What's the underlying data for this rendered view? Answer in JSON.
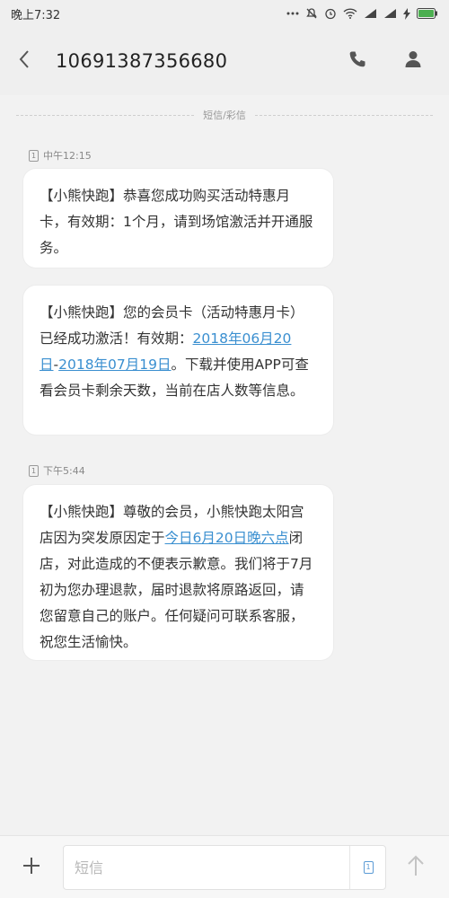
{
  "status_bar": {
    "time": "晚上7:32",
    "battery_color": "#4caf50"
  },
  "header": {
    "title": "10691387356680",
    "back_icon": "chevron-left-icon",
    "call_icon": "phone-icon",
    "contact_icon": "person-icon"
  },
  "divider": {
    "label": "短信/彩信"
  },
  "timestamps": [
    {
      "sim": "1",
      "time": "中午12:15"
    },
    {
      "sim": "1",
      "time": "下午5:44"
    }
  ],
  "messages": [
    {
      "text": "【小熊快跑】恭喜您成功购买活动特惠月卡，有效期：1个月，请到场馆激活并开通服务。"
    },
    {
      "text_pre": "【小熊快跑】您的会员卡（活动特惠月卡）已经成功激活！有效期：",
      "link1": "2018年06月20日",
      "text_mid": "-",
      "link2": "2018年07月19日",
      "text_post": "。下载并使用APP可查看会员卡剩余天数，当前在店人数等信息。"
    },
    {
      "text_pre": "【小熊快跑】尊敬的会员，小熊快跑太阳宫店因为突发原因定于",
      "link1": "今日6月20日晚六点",
      "text_post": "闭店，对此造成的不便表示歉意。我们将于7月初为您办理退款，届时退款将原路返回，请您留意自己的账户。任何疑问可联系客服，祝您生活愉快。"
    }
  ],
  "composer": {
    "placeholder": "短信",
    "sim_label": "1",
    "add_icon": "plus-icon",
    "send_icon": "arrow-up-icon"
  },
  "colors": {
    "link": "#3a8fd0",
    "background": "#f2f2f2",
    "bubble": "#ffffff"
  }
}
